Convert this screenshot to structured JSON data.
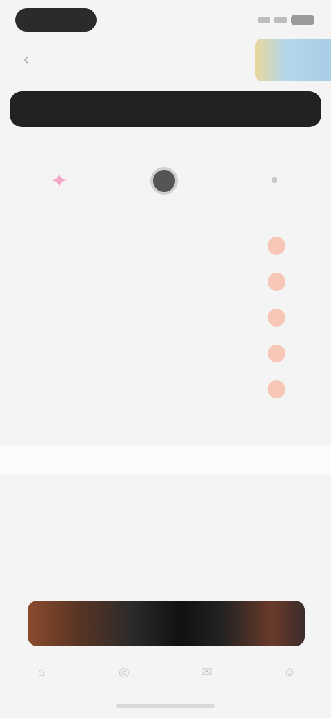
{
  "header": {
    "title": "",
    "back_icon": "chevron-left-icon"
  },
  "banner": {
    "label": ""
  },
  "tabs": [
    {
      "icon": "star-icon",
      "label": ""
    },
    {
      "icon": "record-icon",
      "label": ""
    },
    {
      "icon": "more-icon",
      "label": ""
    }
  ],
  "list": [
    {
      "label": "",
      "has_badge": true
    },
    {
      "label": "",
      "has_badge": true
    },
    {
      "label": "",
      "has_badge": true
    },
    {
      "label": "",
      "has_badge": true
    },
    {
      "label": "",
      "has_badge": true
    },
    {
      "label": "",
      "has_badge": false
    }
  ],
  "list2": [
    {
      "label": ""
    },
    {
      "label": ""
    },
    {
      "label": ""
    }
  ],
  "bottom_tabs": [
    {
      "icon": "home-icon",
      "label": ""
    },
    {
      "icon": "discover-icon",
      "label": ""
    },
    {
      "icon": "message-icon",
      "label": ""
    },
    {
      "icon": "profile-icon",
      "label": ""
    }
  ],
  "colors": {
    "banner_bg": "#222222",
    "badge": "#f6c7b6",
    "accent_pink": "#f2a6c8"
  }
}
